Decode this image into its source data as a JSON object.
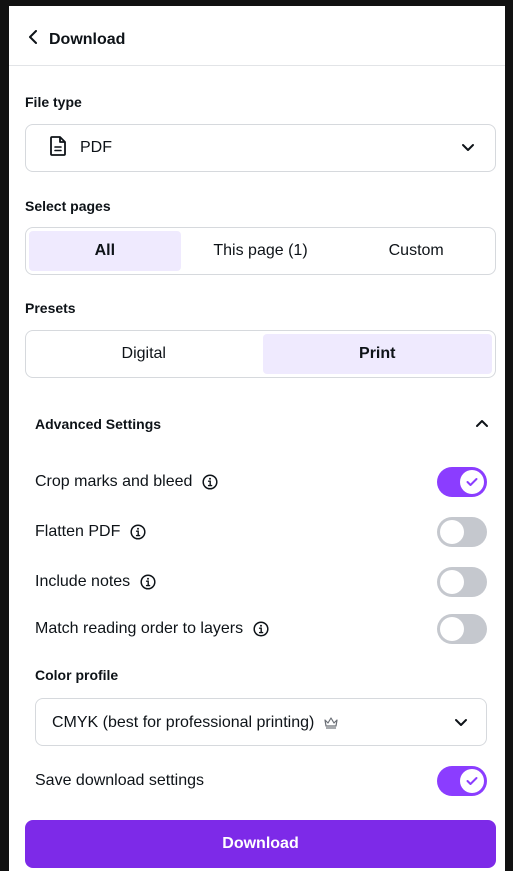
{
  "header": {
    "title": "Download"
  },
  "file_type": {
    "label": "File type",
    "value": "PDF"
  },
  "select_pages": {
    "label": "Select pages",
    "options": [
      "All",
      "This page (1)",
      "Custom"
    ],
    "selected": "All"
  },
  "presets": {
    "label": "Presets",
    "options": [
      "Digital",
      "Print"
    ],
    "selected": "Print"
  },
  "advanced": {
    "title": "Advanced Settings",
    "expanded": true,
    "options": [
      {
        "label": "Crop marks and bleed",
        "on": true
      },
      {
        "label": "Flatten PDF",
        "on": false
      },
      {
        "label": "Include notes",
        "on": false
      },
      {
        "label": "Match reading order to layers",
        "on": false
      }
    ]
  },
  "color_profile": {
    "label": "Color profile",
    "value": "CMYK (best for professional printing)",
    "premium": true
  },
  "save_settings": {
    "label": "Save download settings",
    "on": true
  },
  "download_button": "Download",
  "colors": {
    "accent": "#8b3dff",
    "button": "#7d2ae8",
    "active_segment": "#efeafe",
    "toggle_off": "#c5c8ce"
  }
}
